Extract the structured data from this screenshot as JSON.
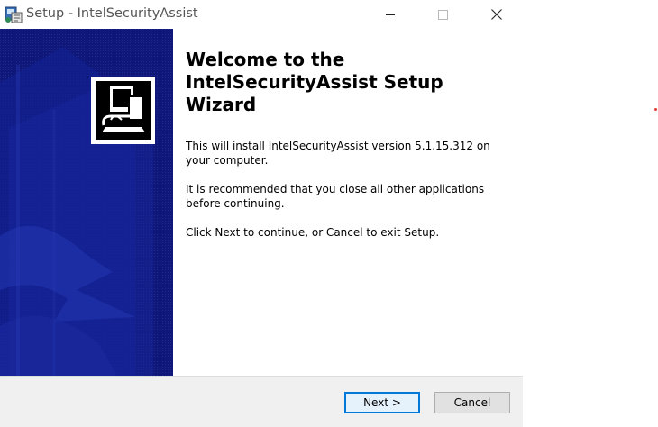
{
  "window": {
    "title": "Setup - IntelSecurityAssist"
  },
  "icons": {
    "app": "setup-app-icon",
    "minimize": "minimize-icon",
    "maximize": "maximize-icon",
    "close": "close-icon",
    "wizard_logo": "installer-computer-icon"
  },
  "colors": {
    "side_panel": "#101a7a",
    "button_focus": "#0078d7",
    "footer": "#f0f0f0"
  },
  "content": {
    "heading": "Welcome to the IntelSecurityAssist Setup Wizard",
    "paragraph1": "This will install IntelSecurityAssist version 5.1.15.312 on your computer.",
    "paragraph2": "It is recommended that you close all other applications before continuing.",
    "paragraph3": "Click Next to continue, or Cancel to exit Setup."
  },
  "buttons": {
    "next": "Next >",
    "cancel": "Cancel"
  }
}
